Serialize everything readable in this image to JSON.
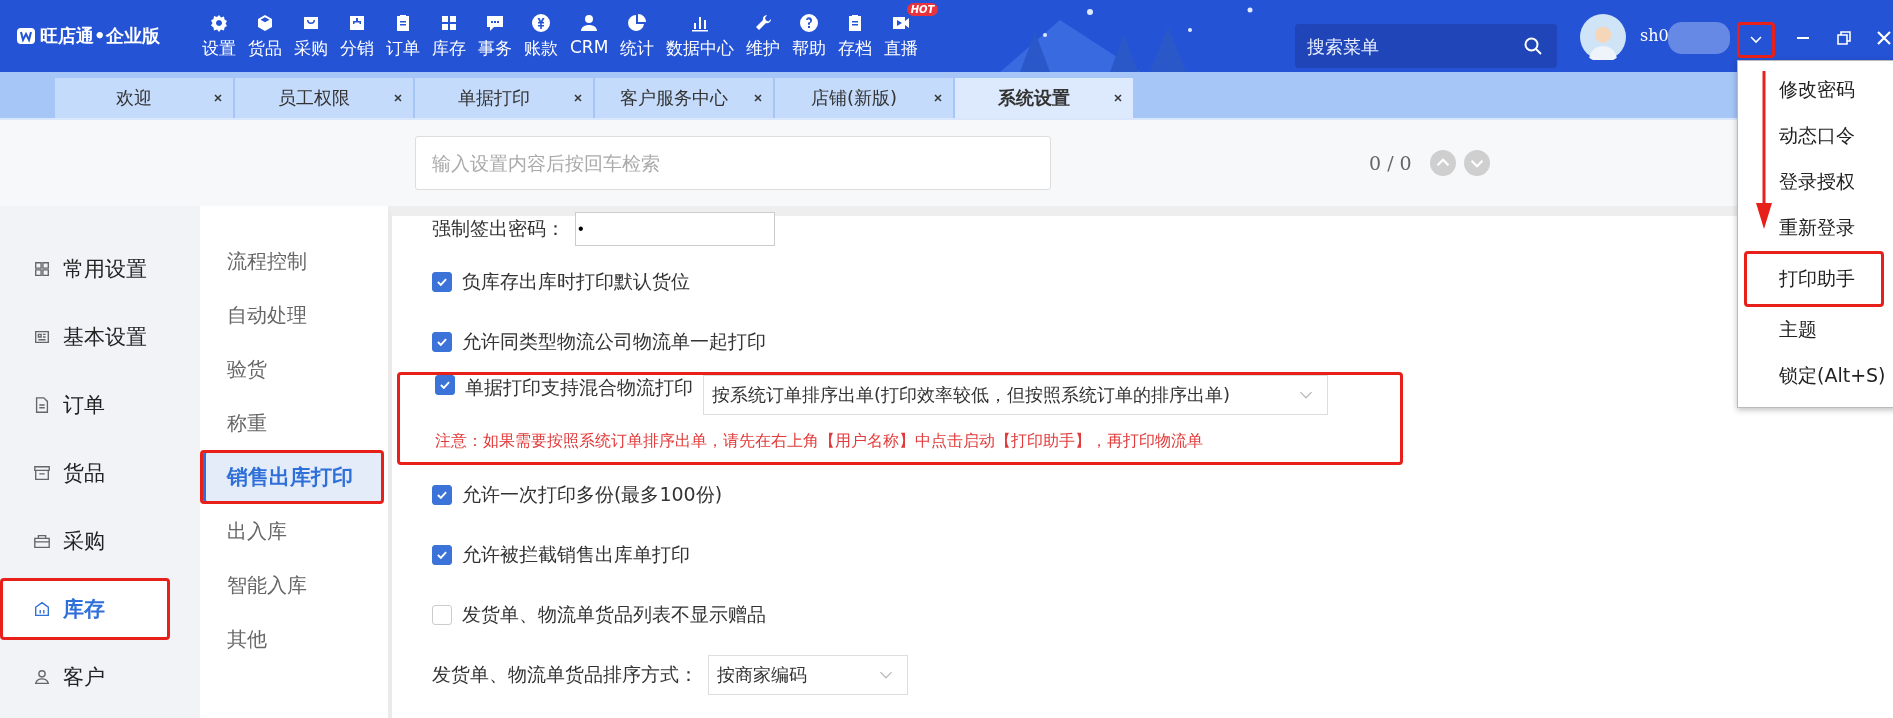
{
  "header": {
    "logo": "旺店通•企业版",
    "menu_search": {
      "placeholder": "搜索菜单"
    },
    "user": {
      "name": "sh0"
    },
    "toolbar": [
      {
        "label": "设置"
      },
      {
        "label": "货品"
      },
      {
        "label": "采购"
      },
      {
        "label": "分销"
      },
      {
        "label": "订单"
      },
      {
        "label": "库存"
      },
      {
        "label": "事务"
      },
      {
        "label": "账款"
      },
      {
        "label": "CRM"
      },
      {
        "label": "统计"
      },
      {
        "label": "数据中心"
      },
      {
        "label": "维护"
      },
      {
        "label": "帮助"
      },
      {
        "label": "存档"
      },
      {
        "label": "直播",
        "badge": "HOT"
      }
    ],
    "user_menu_button": {
      "highlighted": true
    }
  },
  "tabs": [
    {
      "label": "欢迎",
      "selected": false
    },
    {
      "label": "员工权限",
      "selected": false
    },
    {
      "label": "单据打印",
      "selected": false
    },
    {
      "label": "客户服务中心",
      "selected": false
    },
    {
      "label": "店铺(新版)",
      "selected": false
    },
    {
      "label": "系统设置",
      "selected": true
    }
  ],
  "settings_search": {
    "placeholder": "输入设置内容后按回车检索",
    "counter": "0 / 0"
  },
  "nav": [
    {
      "label": "常用设置",
      "selected": false,
      "highlighted": false
    },
    {
      "label": "基本设置",
      "selected": false,
      "highlighted": false
    },
    {
      "label": "订单",
      "selected": false,
      "highlighted": false
    },
    {
      "label": "货品",
      "selected": false,
      "highlighted": false
    },
    {
      "label": "采购",
      "selected": false,
      "highlighted": false
    },
    {
      "label": "库存",
      "selected": true,
      "highlighted": true
    },
    {
      "label": "客户",
      "selected": false,
      "highlighted": false
    }
  ],
  "subnav": [
    {
      "label": "流程控制",
      "selected": false,
      "highlighted": false
    },
    {
      "label": "自动处理",
      "selected": false,
      "highlighted": false
    },
    {
      "label": "验货",
      "selected": false,
      "highlighted": false
    },
    {
      "label": "称重",
      "selected": false,
      "highlighted": false
    },
    {
      "label": "销售出库打印",
      "selected": true,
      "highlighted": true
    },
    {
      "label": "出入库",
      "selected": false,
      "highlighted": false
    },
    {
      "label": "智能入库",
      "selected": false,
      "highlighted": false
    },
    {
      "label": "其他",
      "selected": false,
      "highlighted": false
    }
  ],
  "settings": [
    {
      "kind": "password",
      "label": "强制签出密码：",
      "value": "•"
    },
    {
      "kind": "checkbox",
      "label": "负库存出库时打印默认货位",
      "checked": true
    },
    {
      "kind": "checkbox",
      "label": "允许同类型物流公司物流单一起打印",
      "checked": true
    },
    {
      "kind": "checkbox_select",
      "label": "单据打印支持混合物流打印",
      "checked": true,
      "value": "按系统订单排序出单(打印效率较低，但按照系统订单的排序出单)",
      "note": "注意：如果需要按照系统订单排序出单，请先在右上角【用户名称】中点击启动【打印助手】，再打印物流单",
      "highlighted": true
    },
    {
      "kind": "checkbox",
      "label": "允许一次打印多份(最多100份)",
      "checked": true
    },
    {
      "kind": "checkbox",
      "label": "允许被拦截销售出库单打印",
      "checked": true
    },
    {
      "kind": "checkbox",
      "label": "发货单、物流单货品列表不显示赠品",
      "checked": false
    },
    {
      "kind": "select",
      "label": "发货单、物流单货品排序方式：",
      "value": "按商家编码"
    }
  ],
  "user_menu": [
    {
      "label": "修改密码",
      "highlighted": false
    },
    {
      "label": "动态口令",
      "highlighted": false
    },
    {
      "label": "登录授权",
      "highlighted": false
    },
    {
      "label": "重新登录",
      "highlighted": false
    },
    {
      "label": "打印助手",
      "highlighted": true
    },
    {
      "label": "主题",
      "highlighted": false
    },
    {
      "label": "锁定(Alt+S)",
      "highlighted": false
    }
  ]
}
